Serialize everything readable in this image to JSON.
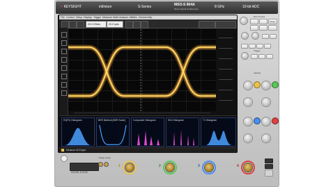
{
  "header": {
    "brand": "KEYSIGHT",
    "product": "infiniium",
    "series": "S-Series",
    "model": "MSO-S 804A",
    "model_sub": "Mixed Signal Oscilloscope",
    "bandwidth": "8 GHz",
    "adc": "10-bit ADC"
  },
  "menu": {
    "items": [
      "File",
      "Control",
      "Setup",
      "Display",
      "Trigger",
      "Measure",
      "Math",
      "Analyze",
      "Utilities",
      "Demos",
      "Help"
    ]
  },
  "toolbar": {
    "sample_rate": "20.0 GSa/s",
    "memory": "20.0 kpts"
  },
  "histograms": [
    {
      "title": "RJ(PJ) Histogram",
      "color": "#4aa0ff"
    },
    {
      "title": "BER Bathtub [BER Scale]",
      "color": "#4aa0ff"
    },
    {
      "title": "Composite Histogram",
      "color": "#e04ad0"
    },
    {
      "title": "DDJ Histogram",
      "color": "#e04ad0"
    },
    {
      "title": "TJ Histogram",
      "color": "#4aa0ff"
    }
  ],
  "status": {
    "measure_label": "Measure All Edges"
  },
  "right_panel": {
    "run_control": "Run Control",
    "single": "Single",
    "trigger": "Trigger",
    "vertical": "Vertical"
  },
  "lower": {
    "digital_label": "DIGITAL D15-D0",
    "probe_comp": "Probe Comp",
    "channels": [
      {
        "num": "1",
        "color": "#e8c24a"
      },
      {
        "num": "2",
        "color": "#58c858"
      },
      {
        "num": "3",
        "color": "#4a8ff0"
      },
      {
        "num": "4",
        "color": "#e04040"
      }
    ]
  },
  "colors": {
    "eye_trace": "#f2a23a",
    "eye_core": "#fff27a",
    "grid": "#2f2f2f"
  }
}
